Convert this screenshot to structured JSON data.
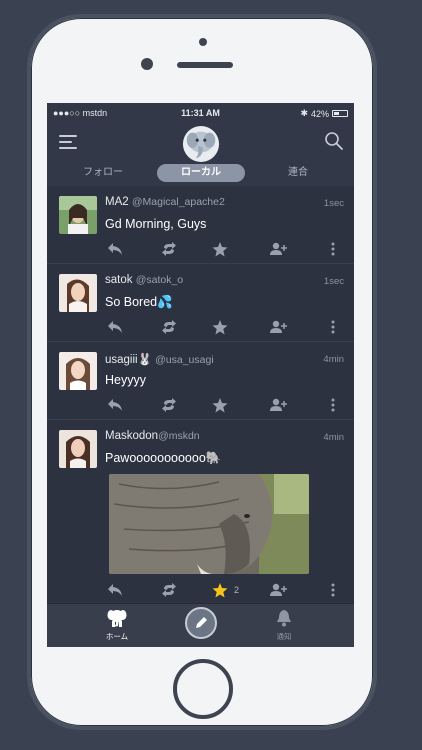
{
  "status_bar": {
    "carrier": "●●●○○ mstdn",
    "time": "11:31 AM",
    "battery": "42%",
    "battery_level": 0.42
  },
  "header": {
    "icons": {
      "menu": "hamburger-menu-icon",
      "logo": "mastodon-elephant-logo",
      "search": "search-icon"
    },
    "tabs": [
      {
        "label": "フォロー",
        "active": false
      },
      {
        "label": "ローカル",
        "active": true
      },
      {
        "label": "連合",
        "active": false
      }
    ]
  },
  "posts": [
    {
      "name": "MA2",
      "handle": "@Magical_apache2",
      "time": "1sec",
      "content": "Gd Morning, Guys",
      "avatar_color": "#6a8f5c"
    },
    {
      "name": "satok",
      "handle": "@satok_o",
      "time": "1sec",
      "content": "So Bored💦",
      "avatar_color": "#d8b8a8"
    },
    {
      "name": "usagiii🐰",
      "handle": "@usa_usagi",
      "time": "4min",
      "content": "Heyyyy",
      "avatar_color": "#e0c0b0"
    },
    {
      "name": "Maskodon",
      "handle": "@mskdn",
      "time": "4min",
      "content": "Pawooooooooooo🐘",
      "avatar_color": "#c8b0a0",
      "favourites": "2",
      "has_image": true
    }
  ],
  "tabbar": {
    "home_label": "ホーム",
    "notifications_label": "通知",
    "icons": {
      "home": "elephant-home-icon",
      "compose": "pencil-icon",
      "notifications": "bell-icon"
    }
  },
  "colors": {
    "background": "#3a4150",
    "screen": "#2c3240",
    "header": "#323848",
    "active_tab": "#8b95a5",
    "star_active": "#f5c518"
  }
}
